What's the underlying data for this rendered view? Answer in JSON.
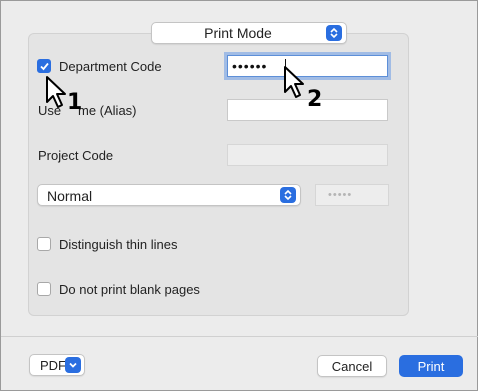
{
  "mode_select": {
    "label": "Print Mode"
  },
  "fields": {
    "department_code": {
      "label": "Department Code",
      "checked": true,
      "value": "••••••"
    },
    "user_name_label": "User Name (Alias)",
    "user_name_visible_start": "Use",
    "user_name_visible_end": "me (Alias)",
    "project_code_label": "Project Code"
  },
  "print_dropdown": {
    "selected": "Normal"
  },
  "pin_field": {
    "placeholder": "•••••"
  },
  "options": [
    {
      "label": "Distinguish thin lines",
      "checked": false
    },
    {
      "label": "Do not print blank pages",
      "checked": false
    }
  ],
  "footer": {
    "pdf_label": "PDF",
    "cancel_label": "Cancel",
    "print_label": "Print"
  },
  "callouts": {
    "first": "1",
    "second": "2"
  },
  "colors": {
    "accent": "#2a6ee0",
    "focus_ring": "#5d8fd8"
  },
  "icons": [
    "stepper-icon",
    "checkmark-icon",
    "chevron-down-icon",
    "pointer-cursor-icon"
  ]
}
